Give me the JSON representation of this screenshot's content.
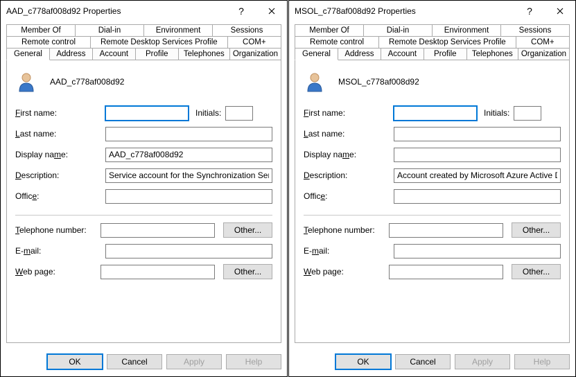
{
  "dialogs": [
    {
      "title": "AAD_c778af008d92 Properties",
      "account_name": "AAD_c778af008d92",
      "fields": {
        "first_name": "",
        "initials": "",
        "last_name": "",
        "display_name": "AAD_c778af008d92",
        "description": "Service account for the Synchronization Service with",
        "office": "",
        "telephone": "",
        "email": "",
        "web_page": ""
      }
    },
    {
      "title": "MSOL_c778af008d92 Properties",
      "account_name": "MSOL_c778af008d92",
      "fields": {
        "first_name": "",
        "initials": "",
        "last_name": "",
        "display_name": "",
        "description": "Account created by Microsoft Azure Active Directory",
        "office": "",
        "telephone": "",
        "email": "",
        "web_page": ""
      }
    }
  ],
  "tabs_row1": [
    "Member Of",
    "Dial-in",
    "Environment",
    "Sessions"
  ],
  "tabs_row2": [
    "Remote control",
    "Remote Desktop Services Profile",
    "COM+"
  ],
  "tabs_row3": [
    "General",
    "Address",
    "Account",
    "Profile",
    "Telephones",
    "Organization"
  ],
  "labels": {
    "first_name_pre": "F",
    "first_name_post": "irst name:",
    "initials": "Initials:",
    "last_name_pre": "L",
    "last_name_post": "ast name:",
    "display_name_pre": "Display na",
    "display_name_u": "m",
    "display_name_post": "e:",
    "description_pre": "D",
    "description_post": "escription:",
    "office_pre": "Offic",
    "office_u": "e",
    "office_post": ":",
    "telephone_pre": "T",
    "telephone_post": "elephone number:",
    "email_pre": "E-",
    "email_u": "m",
    "email_post": "ail:",
    "web_pre": "W",
    "web_post": "eb page:",
    "other": "Other..."
  },
  "buttons": {
    "ok": "OK",
    "cancel": "Cancel",
    "apply": "Apply",
    "help": "Help"
  },
  "title_help": "?"
}
